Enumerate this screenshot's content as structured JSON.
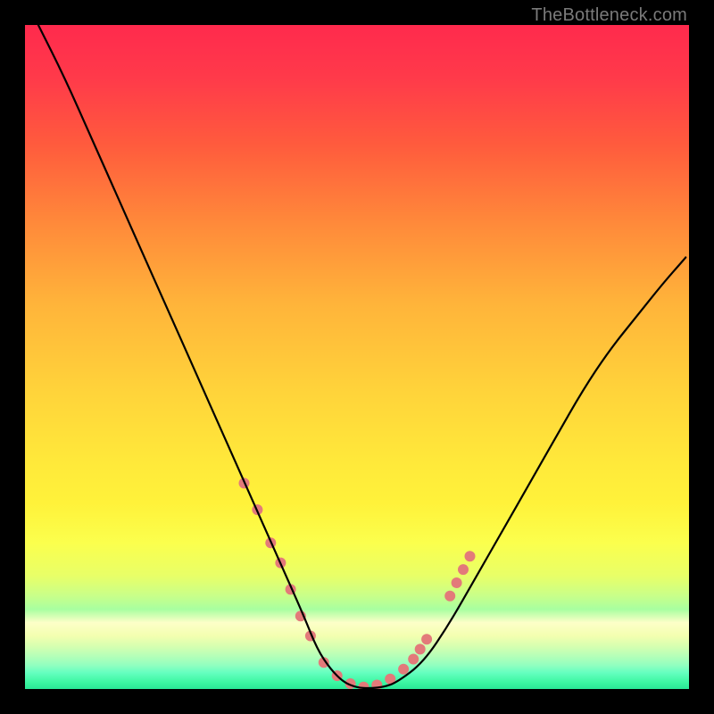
{
  "watermark": "TheBottleneck.com",
  "chart_data": {
    "type": "line",
    "title": "",
    "xlabel": "",
    "ylabel": "",
    "xlim": [
      0,
      100
    ],
    "ylim": [
      0,
      100
    ],
    "grid": false,
    "series": [
      {
        "name": "curve",
        "color": "#000000",
        "x": [
          2,
          6,
          10,
          14,
          18,
          22,
          26,
          30,
          34,
          38,
          42,
          44,
          46,
          48,
          50,
          52,
          54,
          56,
          60,
          64,
          68,
          72,
          76,
          80,
          84,
          88,
          92,
          96,
          99.5
        ],
        "y": [
          100,
          92,
          83,
          74,
          65,
          56,
          47,
          38,
          29,
          20,
          11,
          6,
          3,
          1,
          0.2,
          0.1,
          0.3,
          1,
          4,
          10,
          17,
          24,
          31,
          38,
          45,
          51,
          56,
          61,
          65
        ]
      }
    ],
    "markers": {
      "name": "highlight-dots",
      "color": "#e37a7a",
      "radius_px": 6,
      "x": [
        33,
        35,
        37,
        38.5,
        40,
        41.5,
        43,
        45,
        47,
        49,
        51,
        53,
        55,
        57,
        58.5,
        59.5,
        60.5,
        64,
        65,
        66,
        67
      ],
      "y": [
        31,
        27,
        22,
        19,
        15,
        11,
        8,
        4,
        2,
        0.8,
        0.3,
        0.6,
        1.5,
        3,
        4.5,
        6,
        7.5,
        14,
        16,
        18,
        20
      ]
    }
  }
}
